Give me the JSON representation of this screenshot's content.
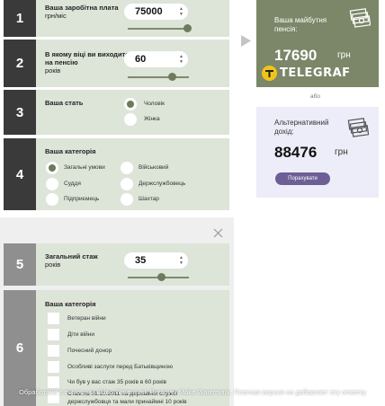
{
  "colors": {
    "dark_number": "#3a3a3a",
    "light_number": "#8f8f8f",
    "row_bg": "#dde4d8",
    "pension_card": "#7b8768",
    "income_card": "#ecedf8",
    "calc_button": "#6d5e95",
    "telegraf_yellow": "#f0c419"
  },
  "salary": {
    "number": "1",
    "label_line1": "Ваша заробітна плата",
    "label_line2": "грн/міс",
    "value": "75000",
    "slider_level": 0.95
  },
  "retire_age": {
    "number": "2",
    "label_line1": "В якому віці ви виходите",
    "label_line2": "на пенсію",
    "label_line3": "років",
    "value": "60",
    "slider_level": 0.7
  },
  "gender": {
    "number": "3",
    "label": "Ваша стать",
    "options": [
      "Чоловік",
      "Жінка"
    ],
    "selected": "Чоловік"
  },
  "category": {
    "number": "4",
    "label": "Ваша категорія",
    "options": [
      "Загальні умови",
      "Військовий",
      "Суддя",
      "Держслужбовець",
      "Підприємець",
      "Шахтар"
    ],
    "selected": "Загальні умови"
  },
  "pension": {
    "title_line1": "Ваша майбутня",
    "title_line2": "пенсія:",
    "value": "17690",
    "unit": "грн",
    "brand": "TELEGRAF",
    "icon": "money-stack-icon"
  },
  "arrow_icon": "play-triangle-icon",
  "or_text": "або",
  "alt_income": {
    "title_line1": "Альтернативний",
    "title_line2": "дохід:",
    "value": "88476",
    "unit": "грн",
    "button_label": "Порахувати",
    "icon": "money-stack-icon"
  },
  "close_icon": "close-icon",
  "experience": {
    "number": "5",
    "label_line1": "Загальний стаж",
    "label_line2": "років",
    "value": "35",
    "slider_level": 0.55
  },
  "category2": {
    "number": "6",
    "label": "Ваша категорія",
    "items": [
      "Ветеран війни",
      "Діти війни",
      "Почесний донор",
      "Особливі заслуги перед Батьківщиною",
      "Чи був у вас стаж 35 років в 60 років",
      "Стаж на 01.10.2011 на державній службі",
      "держслужбовця та мали принаймні 10 років"
    ]
  },
  "watermark": "Обработано с помощью Video Watermark Remover Make Watermark. Платная версия не добавляет эту отметку"
}
